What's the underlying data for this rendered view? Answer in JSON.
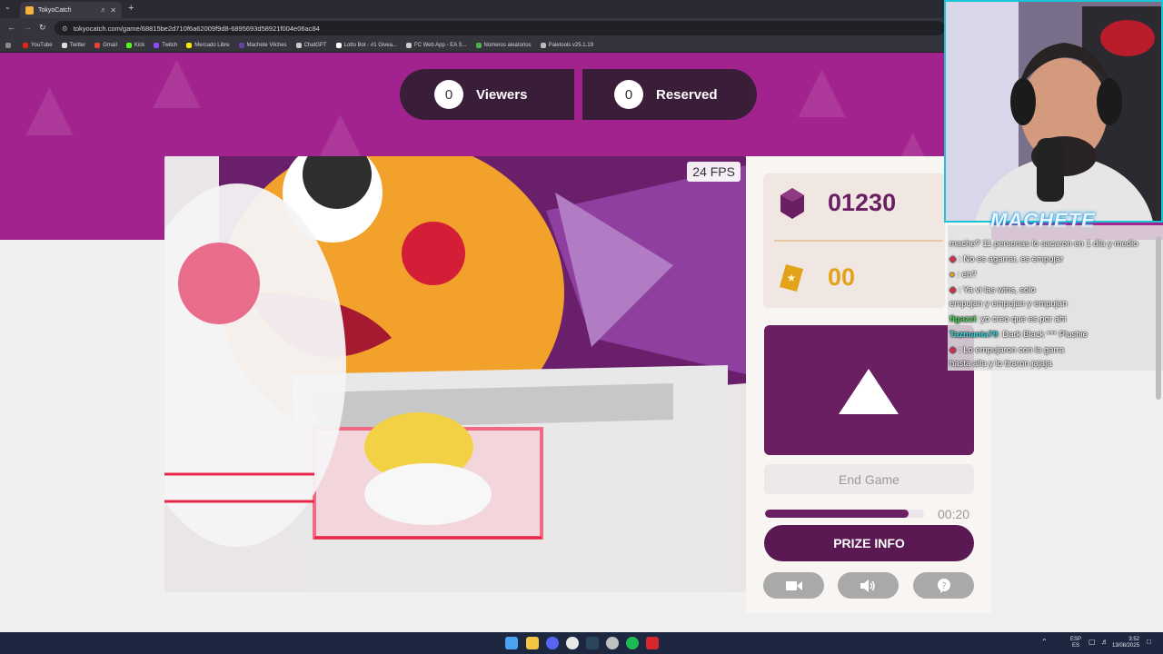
{
  "browser": {
    "tab_title": "TokyoCatch",
    "url": "tokyocatch.com/game/68815be2d710f6a62009f9d8-6895693d58921f004e06ac84",
    "bookmarks": [
      "YouTube",
      "Twitter",
      "Gmail",
      "Kick",
      "Twitch",
      "Mercado Libre",
      "Machete Vilches",
      "ChatGPT",
      "Lotto Bot - #1 Givea...",
      "FC Web App - EA S...",
      "Números aleatorios",
      "Paletools v25.1.19"
    ]
  },
  "header": {
    "viewers_count": "0",
    "viewers_label": "Viewers",
    "reserved_count": "0",
    "reserved_label": "Reserved"
  },
  "camera": {
    "fps_label": "24 FPS"
  },
  "panel": {
    "coins": "01230",
    "tickets": "00",
    "end_game_label": "End Game",
    "timer": "00:20",
    "progress_fraction": 0.9,
    "prize_info_label": "PRIZE INFO"
  },
  "stream": {
    "streamer_name": "MACHETE",
    "chat": [
      {
        "user": "",
        "text": "mache? 11 personas lo sacaron en 1 día y medio"
      },
      {
        "user": "",
        "text": ": No es agarrar, es empujar"
      },
      {
        "user": "",
        "text": ": eh?"
      },
      {
        "user": "",
        "text": ": Ya vi las wins, solo"
      },
      {
        "user": "",
        "text": "empujan y empujan y empujan"
      },
      {
        "user": "figazzi",
        "text": ": yo creo que es por ahi"
      },
      {
        "user": "Tazmania79",
        "text": ": Dark Black *** Plushie"
      },
      {
        "user": "",
        "text": ": Lo empujaron con la garra"
      },
      {
        "user": "",
        "text": "hasta alla y lo tiraron jajaja"
      }
    ]
  },
  "taskbar": {
    "lang_top": "ESP",
    "lang_bottom": "ES",
    "time": "3:52",
    "date": "13/08/2025"
  },
  "colors": {
    "brand_purple": "#6b1f63",
    "hero_magenta": "#a3238e",
    "pill_dark": "#3a1d38",
    "coin_purple": "#6b1f63",
    "ticket_gold": "#e2a21a"
  }
}
